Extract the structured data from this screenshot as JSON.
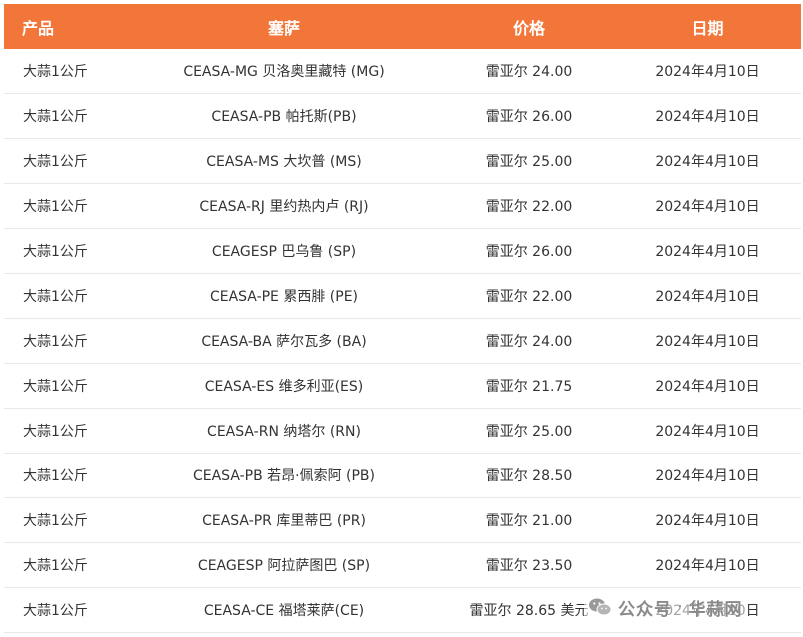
{
  "table": {
    "headers": [
      "产品",
      "塞萨",
      "价格",
      "日期"
    ],
    "rows": [
      {
        "product": "大蒜1公斤",
        "ceasa": "CEASA-MG 贝洛奥里藏特 (MG)",
        "price": "雷亚尔 24.00",
        "date": "2024年4月10日"
      },
      {
        "product": "大蒜1公斤",
        "ceasa": "CEASA-PB 帕托斯(PB)",
        "price": "雷亚尔 26.00",
        "date": "2024年4月10日"
      },
      {
        "product": "大蒜1公斤",
        "ceasa": "CEASA-MS 大坎普 (MS)",
        "price": "雷亚尔 25.00",
        "date": "2024年4月10日"
      },
      {
        "product": "大蒜1公斤",
        "ceasa": "CEASA-RJ 里约热内卢 (RJ)",
        "price": "雷亚尔 22.00",
        "date": "2024年4月10日"
      },
      {
        "product": "大蒜1公斤",
        "ceasa": "CEAGESP 巴乌鲁 (SP)",
        "price": "雷亚尔 26.00",
        "date": "2024年4月10日"
      },
      {
        "product": "大蒜1公斤",
        "ceasa": "CEASA-PE 累西腓 (PE)",
        "price": "雷亚尔 22.00",
        "date": "2024年4月10日"
      },
      {
        "product": "大蒜1公斤",
        "ceasa": "CEASA-BA 萨尔瓦多 (BA)",
        "price": "雷亚尔 24.00",
        "date": "2024年4月10日"
      },
      {
        "product": "大蒜1公斤",
        "ceasa": "CEASA-ES 维多利亚(ES)",
        "price": "雷亚尔 21.75",
        "date": "2024年4月10日"
      },
      {
        "product": "大蒜1公斤",
        "ceasa": "CEASA-RN 纳塔尔 (RN)",
        "price": "雷亚尔 25.00",
        "date": "2024年4月10日"
      },
      {
        "product": "大蒜1公斤",
        "ceasa": "CEASA-PB 若昂·佩索阿 (PB)",
        "price": "雷亚尔 28.50",
        "date": "2024年4月10日"
      },
      {
        "product": "大蒜1公斤",
        "ceasa": "CEASA-PR 库里蒂巴 (PR)",
        "price": "雷亚尔 21.00",
        "date": "2024年4月10日"
      },
      {
        "product": "大蒜1公斤",
        "ceasa": "CEAGESP 阿拉萨图巴 (SP)",
        "price": "雷亚尔 23.50",
        "date": "2024年4月10日"
      },
      {
        "product": "大蒜1公斤",
        "ceasa": "CEASA-CE 福塔莱萨(CE)",
        "price": "雷亚尔 28.65 美元",
        "date": "2024年4月10日"
      }
    ]
  },
  "watermark": {
    "icon": "wechat-icon",
    "source": "公众号",
    "separator": "·",
    "name": "华蒜网"
  },
  "colors": {
    "header_bg": "#f2763a",
    "header_text": "#ffffff",
    "row_border": "#e8e8e8"
  }
}
